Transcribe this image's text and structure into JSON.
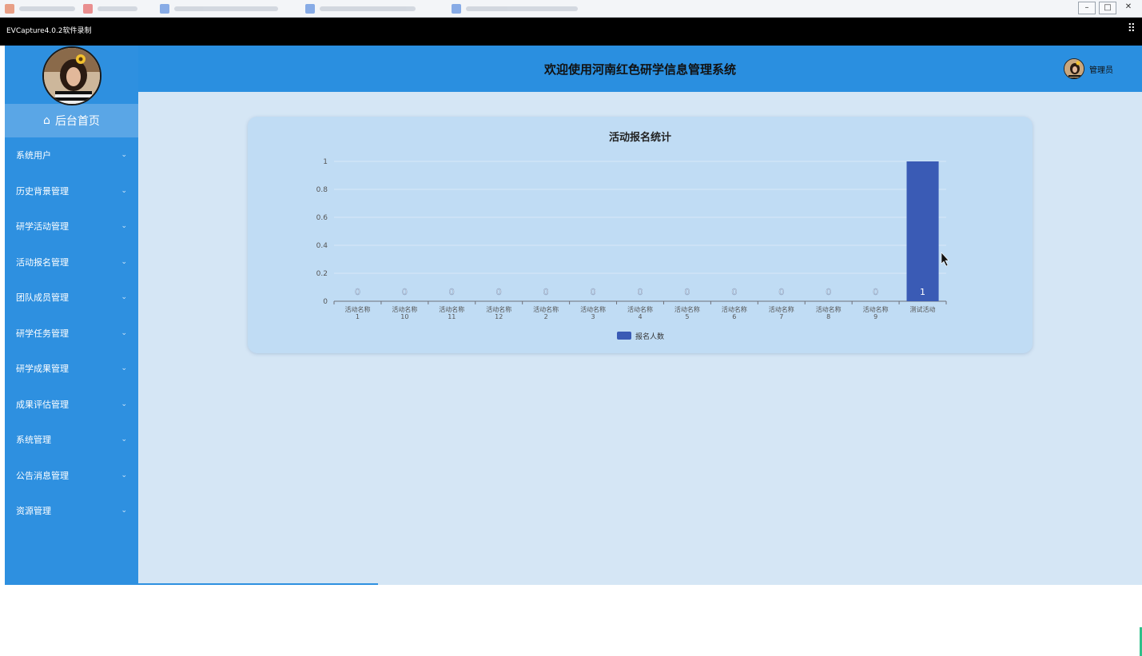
{
  "recorder": {
    "title": "EVCapture4.0.2软件录制"
  },
  "window_controls": {
    "minimize": "–",
    "restore": "□",
    "close": "✕"
  },
  "sidebar": {
    "home_label": "后台首页",
    "items": [
      {
        "label": "系统用户"
      },
      {
        "label": "历史背景管理"
      },
      {
        "label": "研学活动管理"
      },
      {
        "label": "活动报名管理"
      },
      {
        "label": "团队成员管理"
      },
      {
        "label": "研学任务管理"
      },
      {
        "label": "研学成果管理"
      },
      {
        "label": "成果评估管理"
      },
      {
        "label": "系统管理"
      },
      {
        "label": "公告消息管理"
      },
      {
        "label": "资源管理"
      }
    ]
  },
  "header": {
    "title": "欢迎使用河南红色研学信息管理系统",
    "user_label": "管理员"
  },
  "chart_data": {
    "type": "bar",
    "title": "活动报名统计",
    "categories": [
      [
        "活动名称",
        "1"
      ],
      [
        "活动名称",
        "10"
      ],
      [
        "活动名称",
        "11"
      ],
      [
        "活动名称",
        "12"
      ],
      [
        "活动名称",
        "2"
      ],
      [
        "活动名称",
        "3"
      ],
      [
        "活动名称",
        "4"
      ],
      [
        "活动名称",
        "5"
      ],
      [
        "活动名称",
        "6"
      ],
      [
        "活动名称",
        "7"
      ],
      [
        "活动名称",
        "8"
      ],
      [
        "活动名称",
        "9"
      ],
      [
        "测试活动"
      ]
    ],
    "series": [
      {
        "name": "报名人数",
        "values": [
          0,
          0,
          0,
          0,
          0,
          0,
          0,
          0,
          0,
          0,
          0,
          0,
          1
        ]
      }
    ],
    "ylim": [
      0,
      1
    ],
    "yticks": [
      "0",
      "0.2",
      "0.4",
      "0.6",
      "0.8",
      "1"
    ],
    "grid": true,
    "legend": "bottom-center",
    "colors": {
      "bar": "#3a5bb5"
    }
  }
}
